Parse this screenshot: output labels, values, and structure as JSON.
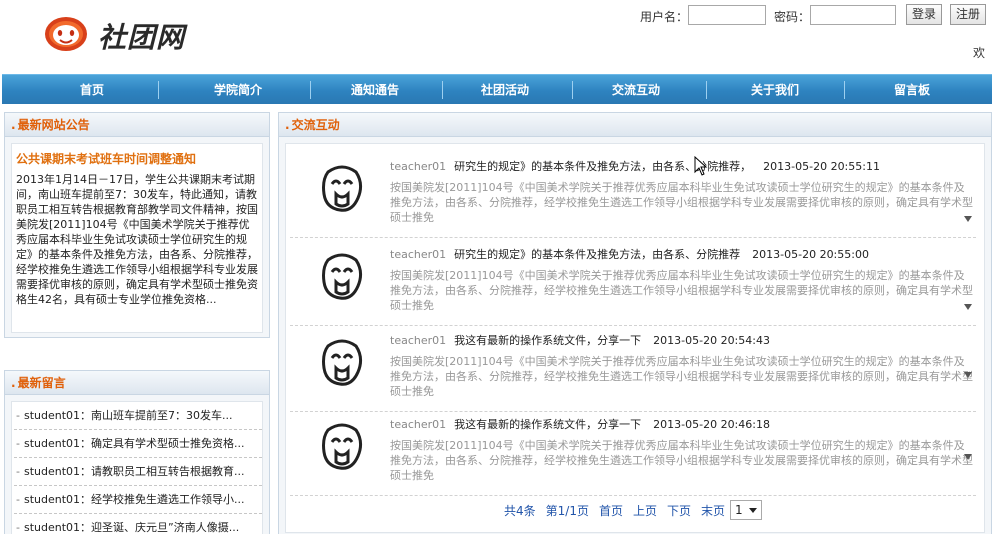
{
  "site": {
    "logo_text": "社团网",
    "accent_color": "#e0600a",
    "nav_color": "#2e83c0"
  },
  "login": {
    "username_label": "用户名：",
    "username_value": "",
    "password_label": "密码：",
    "password_value": "",
    "login_button": "登录",
    "register_button": "注册",
    "welcome_text": "欢"
  },
  "nav": {
    "items": [
      {
        "label": "首页"
      },
      {
        "label": "学院简介"
      },
      {
        "label": "通知通告"
      },
      {
        "label": "社团活动"
      },
      {
        "label": "交流互动"
      },
      {
        "label": "关于我们"
      },
      {
        "label": "留言板"
      }
    ]
  },
  "notice_panel": {
    "title": "最新网站公告",
    "headline": "公共课期末考试班车时间调整通知",
    "body": "2013年1月14日－17日，学生公共课期末考试期间，南山班车提前至7：30发车，特此通知，请教职员工相互转告根据教育部教学司文件精神，按国美院发[2011]104号《中国美术学院关于推荐优秀应届本科毕业生免试攻读硕士学位研究生的规定》的基本条件及推免方法，由各系、分院推荐，经学校推免生遴选工作领导小组根据学科专业发展需要择优审核的原则，确定具有学术型硕士推免资格生42名，具有硕士专业学位推免资格..."
  },
  "messages_panel": {
    "title": "最新留言",
    "items": [
      {
        "text": "student01：南山班车提前至7：30发车..."
      },
      {
        "text": "student01：确定具有学术型硕士推免资格..."
      },
      {
        "text": "student01：请教职员工相互转告根据教育..."
      },
      {
        "text": "student01：经学校推免生遴选工作领导小..."
      },
      {
        "text": "student01：迎圣诞、庆元旦”济南人像摄..."
      }
    ]
  },
  "exchange_panel": {
    "title": "交流互动",
    "posts": [
      {
        "author": "teacher01",
        "title": "研究生的规定》的基本条件及推免方法，由各系、分院推荐，",
        "time": "2013-05-20 20:55:11",
        "body": "按国美院发[2011]104号《中国美术学院关于推荐优秀应届本科毕业生免试攻读硕士学位研究生的规定》的基本条件及推免方法，由各系、分院推荐，经学校推免生遴选工作领导小组根据学科专业发展需要择优审核的原则，确定具有学术型硕士推免"
      },
      {
        "author": "teacher01",
        "title": "研究生的规定》的基本条件及推免方法，由各系、分院推荐",
        "time": "2013-05-20 20:55:00",
        "body": "按国美院发[2011]104号《中国美术学院关于推荐优秀应届本科毕业生免试攻读硕士学位研究生的规定》的基本条件及推免方法，由各系、分院推荐，经学校推免生遴选工作领导小组根据学科专业发展需要择优审核的原则，确定具有学术型硕士推免"
      },
      {
        "author": "teacher01",
        "title": "我这有最新的操作系统文件，分享一下",
        "time": "2013-05-20 20:54:43",
        "body": "按国美院发[2011]104号《中国美术学院关于推荐优秀应届本科毕业生免试攻读硕士学位研究生的规定》的基本条件及推免方法，由各系、分院推荐，经学校推免生遴选工作领导小组根据学科专业发展需要择优审核的原则，确定具有学术型硕士推免"
      },
      {
        "author": "teacher01",
        "title": "我这有最新的操作系统文件，分享一下",
        "time": "2013-05-20 20:46:18",
        "body": "按国美院发[2011]104号《中国美术学院关于推荐优秀应届本科毕业生免试攻读硕士学位研究生的规定》的基本条件及推免方法，由各系、分院推荐，经学校推免生遴选工作领导小组根据学科专业发展需要择优审核的原则，确定具有学术型硕士推免"
      }
    ]
  },
  "pager": {
    "total": "共4条",
    "page_info": "第1/1页",
    "first": "首页",
    "prev": "上页",
    "next": "下页",
    "last": "末页",
    "selected_page": "1"
  }
}
